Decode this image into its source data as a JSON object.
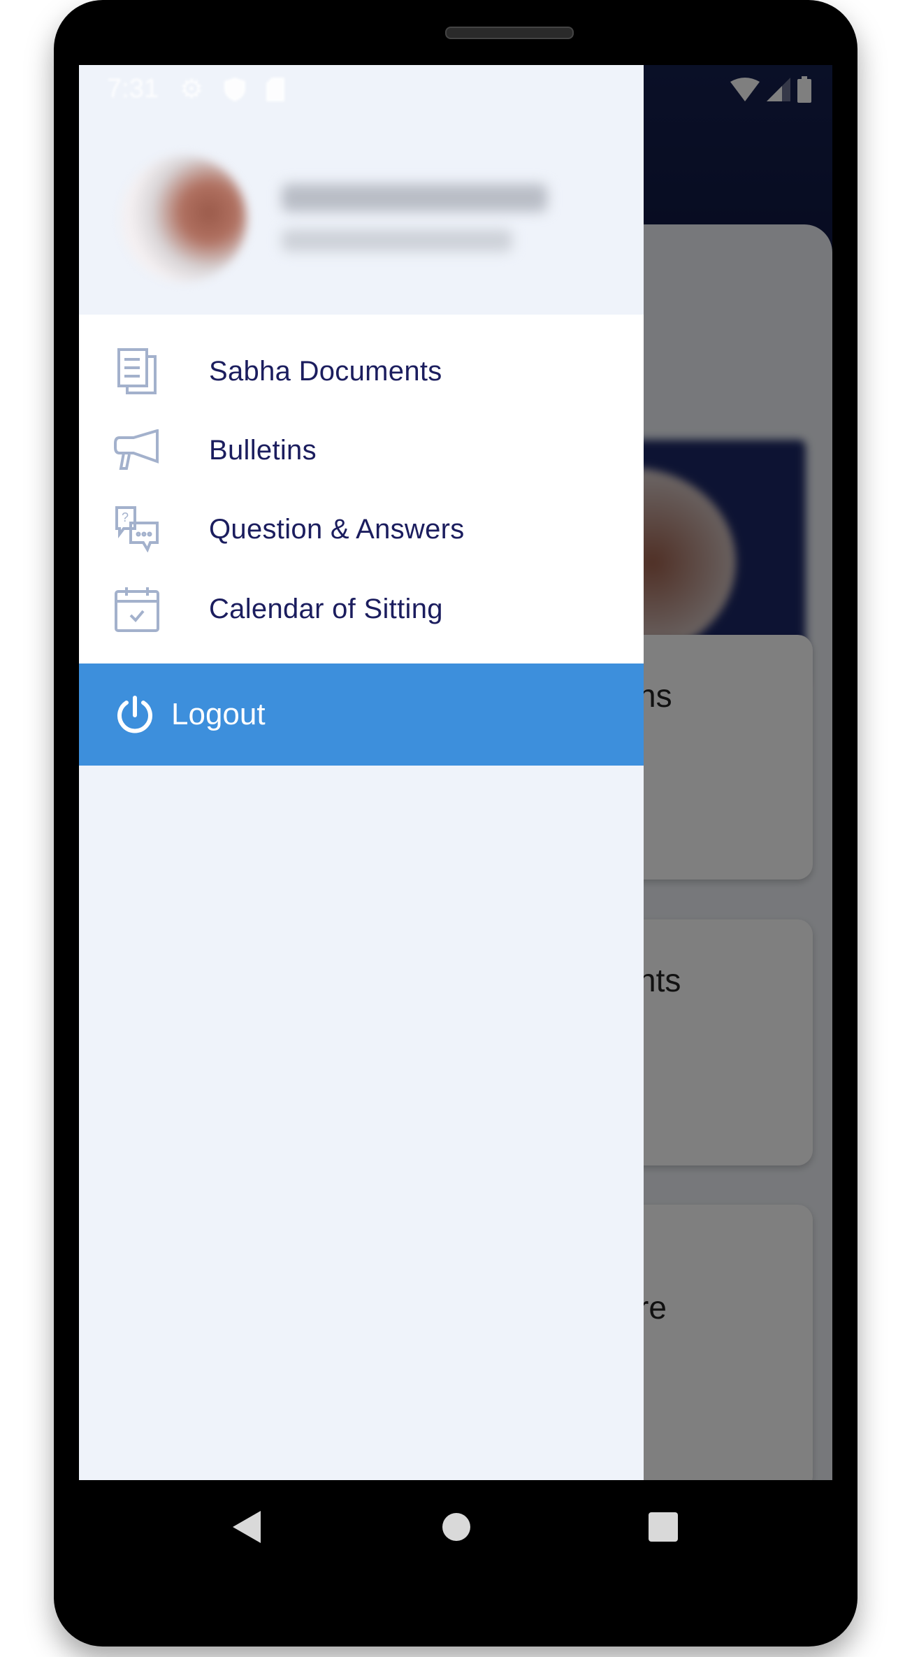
{
  "status_bar": {
    "time": "7:31",
    "left_icons": [
      "gear-icon",
      "shield-play-icon",
      "sd-card-icon"
    ],
    "right_icons": [
      "wifi-icon",
      "signal-icon",
      "battery-icon"
    ]
  },
  "background": {
    "cards": [
      {
        "partial_label": "ns"
      },
      {
        "partial_label": "nts"
      },
      {
        "partial_label": "re"
      }
    ]
  },
  "drawer": {
    "menu": [
      {
        "label": "Sabha Documents",
        "icon": "documents-icon"
      },
      {
        "label": "Bulletins",
        "icon": "megaphone-icon"
      },
      {
        "label": "Question & Answers",
        "icon": "chat-question-icon"
      },
      {
        "label": "Calendar of Sitting",
        "icon": "calendar-check-icon"
      }
    ],
    "logout": {
      "label": "Logout",
      "icon": "power-icon"
    }
  },
  "colors": {
    "accent": "#3d8fdc",
    "menu_text": "#1b1d5e",
    "icon": "#a3b1cc",
    "drawer_bg": "#eff3fa",
    "appbar": "#0e1640"
  },
  "nav_bar": {
    "buttons": [
      "back-icon",
      "home-icon",
      "recents-icon"
    ]
  }
}
